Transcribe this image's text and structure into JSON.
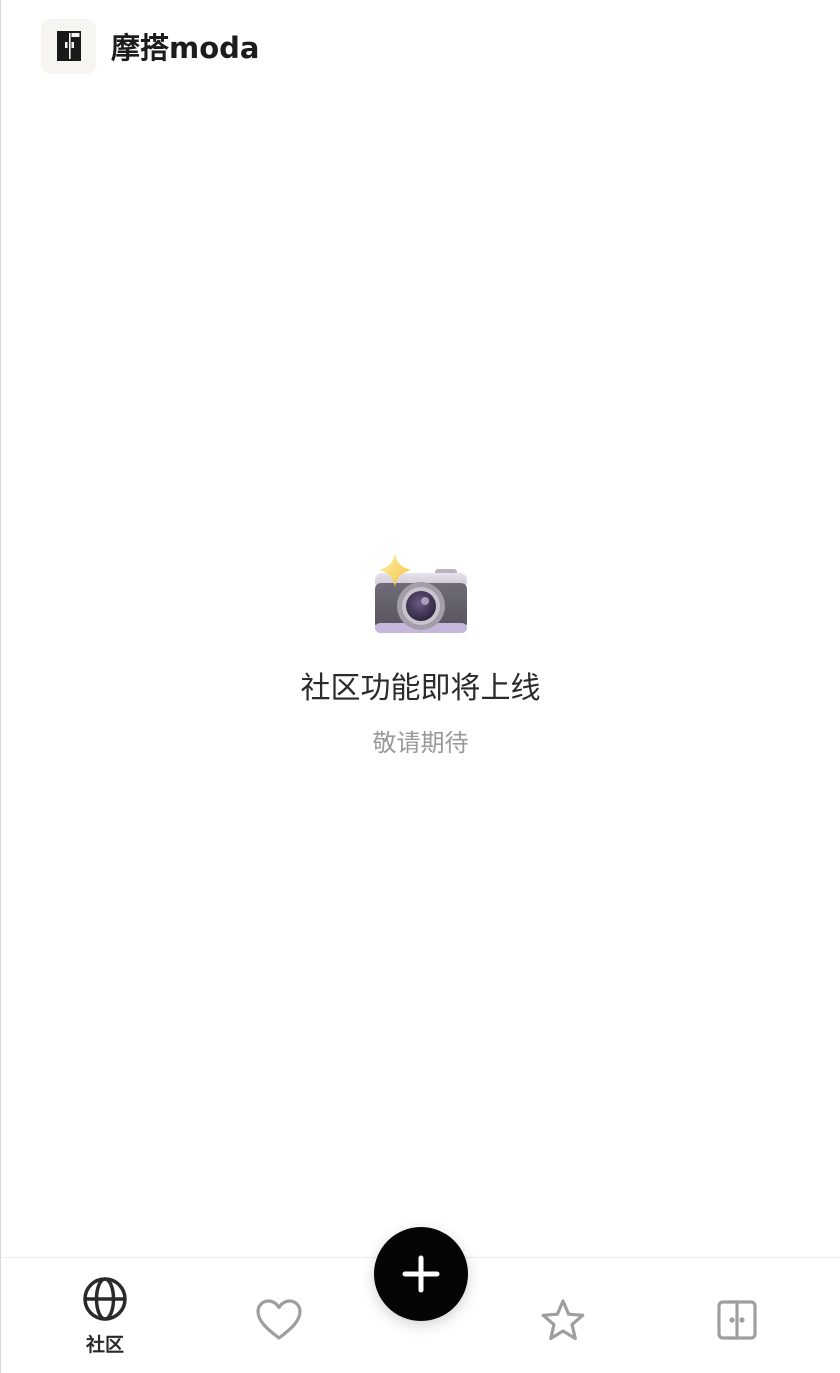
{
  "header": {
    "app_title": "摩搭moda",
    "logo_icon": "wardrobe-logo-icon"
  },
  "empty_state": {
    "icon": "camera-with-sparkle-icon",
    "title": "社区功能即将上线",
    "subtitle": "敬请期待"
  },
  "tabbar": {
    "items": [
      {
        "icon": "globe-icon",
        "label": "社区",
        "active": true
      },
      {
        "icon": "heart-icon",
        "label": "",
        "active": false
      },
      {
        "icon": "star-icon",
        "label": "",
        "active": false
      },
      {
        "icon": "wardrobe-icon",
        "label": "",
        "active": false
      }
    ],
    "fab_icon": "plus-icon"
  },
  "colors": {
    "text_primary": "#1c1c1c",
    "text_secondary": "#9a9a9a",
    "icon_inactive": "#9e9e9e",
    "icon_active": "#2a2a2a",
    "fab_background": "#050505"
  }
}
